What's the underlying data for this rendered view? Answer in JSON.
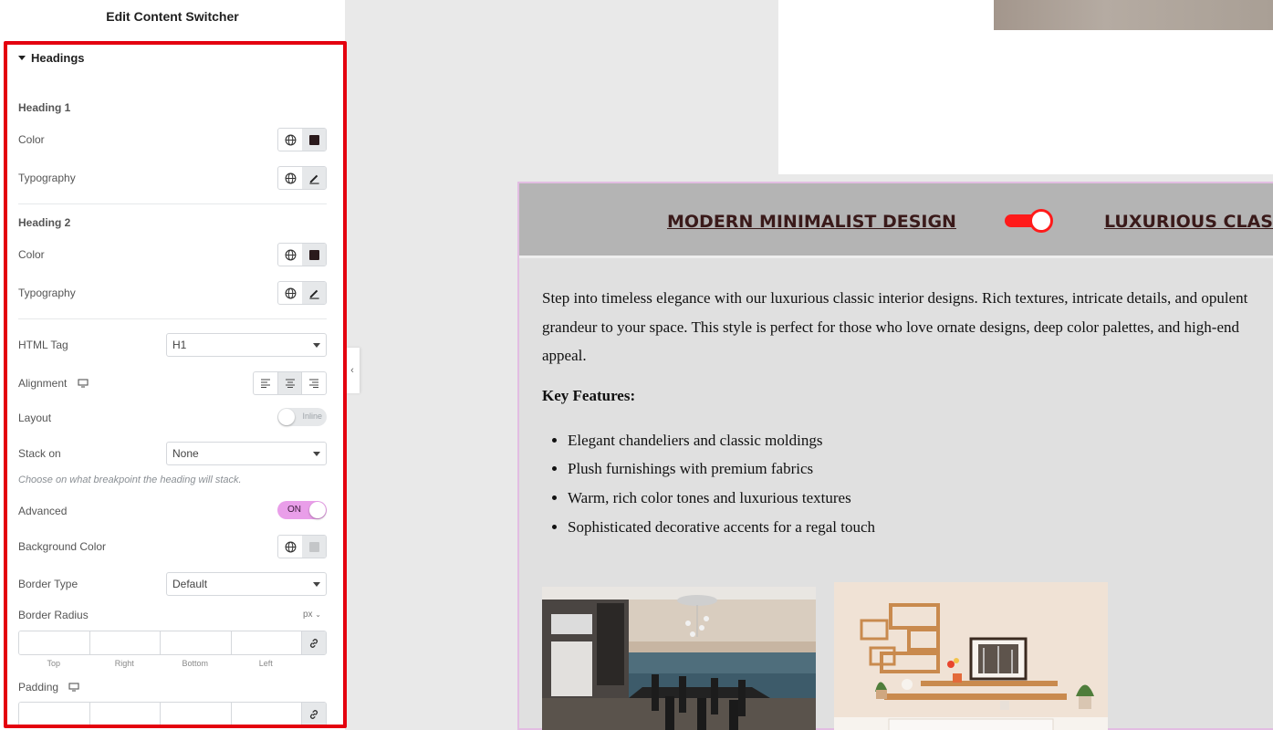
{
  "panel": {
    "title": "Edit Content Switcher",
    "section_title": "Headings",
    "heading1": {
      "title": "Heading 1",
      "color_label": "Color",
      "typography_label": "Typography"
    },
    "heading2": {
      "title": "Heading 2",
      "color_label": "Color",
      "typography_label": "Typography"
    },
    "html_tag": {
      "label": "HTML Tag",
      "value": "H1"
    },
    "alignment": {
      "label": "Alignment",
      "active": "center"
    },
    "layout": {
      "label": "Layout",
      "toggle_text": "Inline",
      "on": false
    },
    "stack_on": {
      "label": "Stack on",
      "value": "None",
      "hint": "Choose on what breakpoint the heading will stack."
    },
    "advanced": {
      "label": "Advanced",
      "toggle_text": "ON",
      "on": true
    },
    "background_color": {
      "label": "Background Color"
    },
    "border_type": {
      "label": "Border Type",
      "value": "Default"
    },
    "border_radius": {
      "label": "Border Radius",
      "unit": "px",
      "fields": [
        "Top",
        "Right",
        "Bottom",
        "Left"
      ]
    },
    "padding": {
      "label": "Padding"
    },
    "colors": {
      "heading_swatch": "#2b1a1c",
      "bg_swatch": "#c4c6c8",
      "frame": "#e4000f"
    }
  },
  "preview": {
    "switcher": {
      "primary_heading": "MODERN MINIMALIST DESIGN",
      "secondary_heading": "LUXURIOUS CLASSIC",
      "toggle_state": "secondary",
      "toggle_color": "#ff1a1a"
    },
    "content": {
      "intro_lines": [
        "Step into timeless elegance with our luxurious classic interior designs. Rich textures, intricate details, and opulent",
        "grandeur to your space. This style is perfect for those who love ornate designs, deep color palettes, and high-end",
        "appeal."
      ],
      "key_features_title": "Key Features:",
      "features": [
        "Elegant chandeliers and classic moldings",
        "Plush furnishings with premium fabrics",
        "Warm, rich color tones and luxurious textures",
        "Sophisticated decorative accents for a regal touch"
      ]
    },
    "images": [
      "dining-room-ocean-view",
      "living-room-wall-shelves"
    ]
  }
}
